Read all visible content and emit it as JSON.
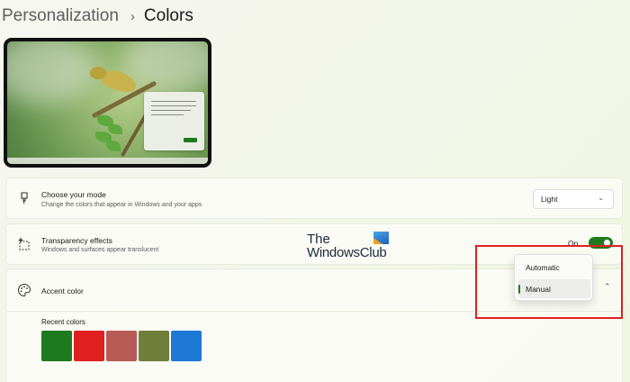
{
  "breadcrumb": {
    "parent": "Personalization",
    "separator": "›",
    "current": "Colors"
  },
  "preview": {
    "description_icon": "wallpaper-preview"
  },
  "mode": {
    "title": "Choose your mode",
    "subtitle": "Change the colors that appear in Windows and your apps",
    "selected": "Light",
    "icon": "brush-icon"
  },
  "transparency": {
    "title": "Transparency effects",
    "subtitle": "Windows and surfaces appear translucent",
    "state_label": "On",
    "enabled": true,
    "icon": "transparency-icon"
  },
  "watermark": {
    "line1": "The",
    "line2": "WindowsClub"
  },
  "accent": {
    "title": "Accent color",
    "icon": "palette-icon",
    "recent_label": "Recent colors",
    "recent_colors": [
      "#1e7a1e",
      "#e02020",
      "#b85a55",
      "#6f7e3a",
      "#1e78d6"
    ],
    "dropdown_options": [
      "Automatic",
      "Manual"
    ],
    "dropdown_selected": "Manual"
  },
  "colors": {
    "accent": "#1e7a1e",
    "highlight": "#e02020"
  }
}
